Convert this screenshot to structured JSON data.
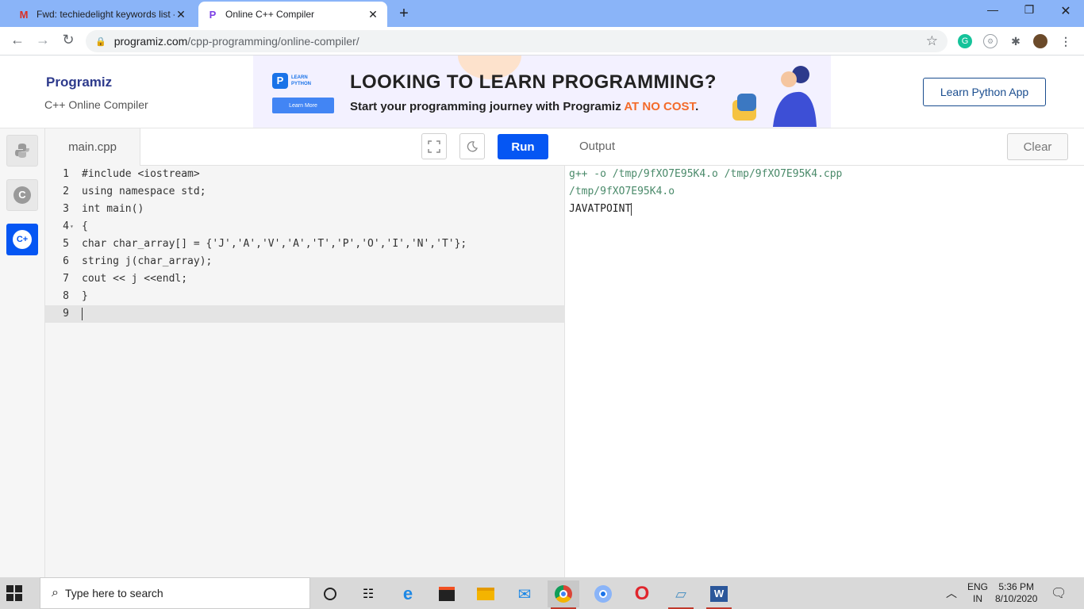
{
  "browser": {
    "tabs": [
      {
        "title": "Fwd: techiedelight keywords list -",
        "icon": "gmail-icon"
      },
      {
        "title": "Online C++ Compiler",
        "icon": "programiz-icon"
      }
    ],
    "url": {
      "host": "programiz.com",
      "path": "/cpp-programming/online-compiler/"
    }
  },
  "header": {
    "logo": "Programiz",
    "subtitle": "C++ Online Compiler",
    "banner": {
      "badge": "LEARN PYTHON",
      "button": "Learn More",
      "headline": "LOOKING TO LEARN PROGRAMMING?",
      "sub_prefix": "Start your programming journey with Programiz ",
      "sub_highlight": "AT NO COST",
      "sub_suffix": "."
    },
    "app_button": "Learn Python App"
  },
  "sidebar": {
    "items": [
      {
        "name": "python",
        "icon": "python-icon"
      },
      {
        "name": "c",
        "icon": "c-icon"
      },
      {
        "name": "cpp",
        "icon": "cpp-icon",
        "active": true
      }
    ]
  },
  "editor": {
    "file_tab": "main.cpp",
    "run_label": "Run",
    "lines": [
      {
        "n": "1",
        "text": "#include <iostream>"
      },
      {
        "n": "2",
        "text": "using namespace std;"
      },
      {
        "n": "3",
        "text": "int main()"
      },
      {
        "n": "4",
        "text": "{"
      },
      {
        "n": "5",
        "text": "char char_array[] = {'J','A','V','A','T','P','O','I','N','T'};"
      },
      {
        "n": "6",
        "text": "string j(char_array);"
      },
      {
        "n": "7",
        "text": "cout << j <<endl;"
      },
      {
        "n": "8",
        "text": "}"
      },
      {
        "n": "9",
        "text": ""
      }
    ]
  },
  "output": {
    "label": "Output",
    "clear_label": "Clear",
    "lines": [
      "g++ -o /tmp/9fXO7E95K4.o /tmp/9fXO7E95K4.cpp",
      "/tmp/9fXO7E95K4.o",
      "JAVATPOINT"
    ]
  },
  "taskbar": {
    "search_placeholder": "Type here to search",
    "lang_top": "ENG",
    "lang_bottom": "IN",
    "time": "5:36 PM",
    "date": "8/10/2020"
  },
  "colors": {
    "run_button": "#0556f3",
    "tabstrip": "#8ab4f8",
    "highlight": "#f36b2a"
  }
}
